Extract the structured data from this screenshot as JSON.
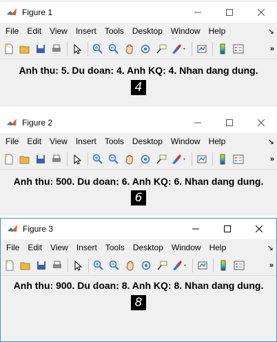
{
  "figures": [
    {
      "title": "Figure 1",
      "caption": "Anh thu: 5. Du doan: 4. Anh KQ: 4. Nhan dang dung.",
      "digit": "4"
    },
    {
      "title": "Figure 2",
      "caption": "Anh thu: 500. Du doan: 6. Anh KQ: 6. Nhan dang dung.",
      "digit": "6"
    },
    {
      "title": "Figure 3",
      "caption": "Anh thu: 900. Du doan: 8. Anh KQ: 8. Nhan dang dung.",
      "digit": "8"
    }
  ],
  "menu": {
    "file": "File",
    "edit": "Edit",
    "view": "View",
    "insert": "Insert",
    "tools": "Tools",
    "desktop": "Desktop",
    "window": "Window",
    "help": "Help"
  },
  "toolbar_icons": [
    "new-file-icon",
    "open-folder-icon",
    "save-icon",
    "print-icon",
    "pointer-icon",
    "zoom-in-icon",
    "zoom-out-icon",
    "pan-icon",
    "rotate-3d-icon",
    "data-cursor-icon",
    "brush-icon",
    "link-plot-icon",
    "colorbar-icon",
    "legend-icon"
  ],
  "colors": {
    "active_border": "#3c8fd6",
    "titlebar": "#ffffff",
    "background": "#f0f0f0"
  }
}
